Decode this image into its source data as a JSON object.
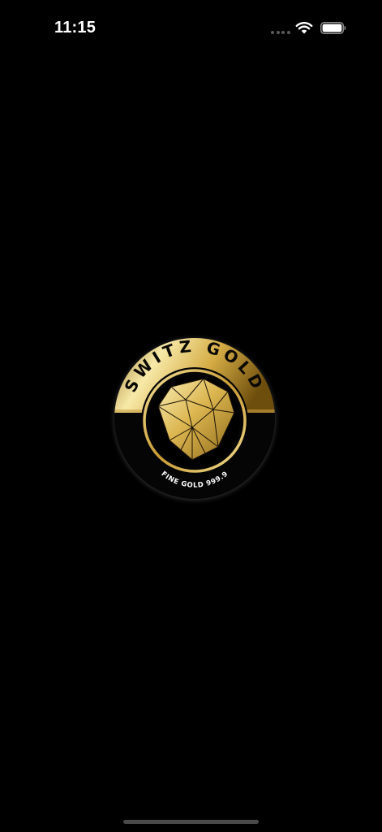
{
  "status_bar": {
    "time": "11:15",
    "icons": [
      "cellular-dots-icon",
      "wifi-icon",
      "battery-icon"
    ]
  },
  "logo": {
    "brand": "SWITZ GOLD",
    "tagline": "FINE GOLD 999.9",
    "icon": "gold-diamond-emblem",
    "colors": {
      "gold_light": "#f6e7a2",
      "gold_mid": "#d9b14c",
      "gold_dark": "#8a6414",
      "background": "#000000"
    }
  },
  "home_indicator": {
    "color": "#4a4a4a"
  }
}
